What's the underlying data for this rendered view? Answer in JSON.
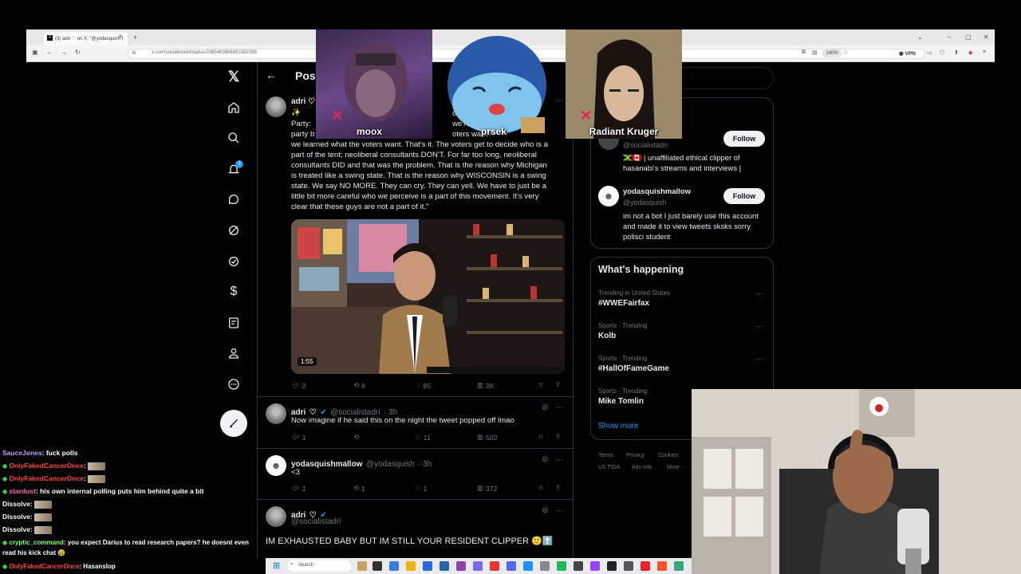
{
  "browser": {
    "tab_title": "(3) adri ♡ on X: \"@yodasquich I",
    "url": "x.com/socialistadri/status/20854636568815823​99",
    "zoom": "140%",
    "vpn_label": "VPN"
  },
  "nav": {
    "badge_count": "3"
  },
  "main": {
    "header": "Post",
    "post": {
      "author": "adri",
      "party_fragment": "Party:",
      "text_partial": [
        "we learned what the voters want. That's it. The voters get to decide who is a",
        "part of the tent; neoliberal consultants DON'T. For far too long, neoliberal",
        "consultants DID and that was the problem. That is the reason why Michigan",
        "is treated like a swing state. That is the reason why WISCONSIN is a swing",
        "state. We say NO MORE. They can cry. They can yell. We have to just be a",
        "little bit more careful who we perceive is a part of this movement. It's very",
        "clear that these guys are not a part of it.\""
      ],
      "hidden_fragments": [
        "onsultan",
        "we're here",
        "s want?",
        "oters want?",
        "party b"
      ],
      "video_duration": "1:55",
      "replies": "2",
      "reposts": "8",
      "likes": "85",
      "views": "2K"
    },
    "replies": [
      {
        "author": "adri",
        "handle": "@socialistadri",
        "time": "· 3h",
        "text": "Now imagine if he said this on the night the tweet popped off lmao",
        "replies": "1",
        "reposts": "",
        "likes": "11",
        "views": "502"
      },
      {
        "author": "yodasquishmallow",
        "handle": "@yodasquish",
        "time": "· 3h",
        "text": "<3",
        "replies": "1",
        "reposts": "1",
        "likes": "1",
        "views": "372"
      },
      {
        "author": "adri",
        "handle": "@socialistadri",
        "text": "IM EXHAUSTED BABY BUT IM STILL YOUR RESIDENT CLIPPER 🙂⬆️"
      }
    ]
  },
  "sidebar": {
    "who_to_follow": [
      {
        "handle": "@socialistadri",
        "bio": "🇯🇲🇨🇦 | unaffiliated ethical clipper of hasanabi's streams and interviews |",
        "follow_label": "Follow"
      },
      {
        "name": "yodasquishmallow",
        "handle": "@yodasquish",
        "bio": "im not a bot I just barely use this account and made it to view tweets sksks sorry polisci student",
        "follow_label": "Follow"
      }
    ],
    "happening_title": "What's happening",
    "trends": [
      {
        "category": "Trending in United States",
        "name": "#WWEFairfax"
      },
      {
        "category": "Sports · Trending",
        "name": "Kolb"
      },
      {
        "category": "Sports · Trending",
        "name": "#HallOfFameGame"
      },
      {
        "category": "Sports · Trending",
        "name": "Mike Tomlin"
      }
    ],
    "show_more": "Show more",
    "footer": [
      "Terms",
      "Privacy",
      "Cookies",
      "US TIDA",
      "Ads info",
      "More ···"
    ]
  },
  "overlays": {
    "emote1": "moox",
    "emote2": "prsek",
    "emote3": "Radiant Kruger"
  },
  "chat": [
    {
      "user": "SauceJones",
      "color": "#c9a0ff",
      "msg": ": fuck polls",
      "badge": false,
      "emote": false
    },
    {
      "user": "OnlyFakedCancerOnce",
      "color": "#ff4545",
      "msg": ":",
      "badge": true,
      "emote": true
    },
    {
      "user": "OnlyFakedCancerOnce",
      "color": "#ff4545",
      "msg": ":",
      "badge": true,
      "emote": true
    },
    {
      "user": "stardust",
      "color": "#ff69b4",
      "msg": ": his own internal polling puts him behind quite a bit",
      "badge": true,
      "emote": false
    },
    {
      "user": "Dissolve",
      "color": "#ffffff",
      "msg": ":",
      "badge": false,
      "emote": true
    },
    {
      "user": "Dissolve",
      "color": "#ffffff",
      "msg": ":",
      "badge": false,
      "emote": true
    },
    {
      "user": "Dissolve",
      "color": "#ffffff",
      "msg": ":",
      "badge": false,
      "emote": true
    },
    {
      "user": "cryptic_command",
      "color": "#7dff7d",
      "msg": ": you expect Darius to read research papers? he doesnt even",
      "badge": true,
      "emote": false
    },
    {
      "user": "",
      "color": "#ffffff",
      "msg": "read his kick chat",
      "badge": false,
      "emote": false
    },
    {
      "user": "OnlyFakedCancerOnce",
      "color": "#ff4545",
      "msg": ": Hasanslop",
      "badge": true,
      "emote": false
    }
  ],
  "taskbar": {
    "search_placeholder": "Search"
  },
  "colors": {
    "accent": "#1d9bf0",
    "background": "#000000",
    "text_primary": "#e7e9ea",
    "text_secondary": "#71767b",
    "border": "#2f3336"
  }
}
